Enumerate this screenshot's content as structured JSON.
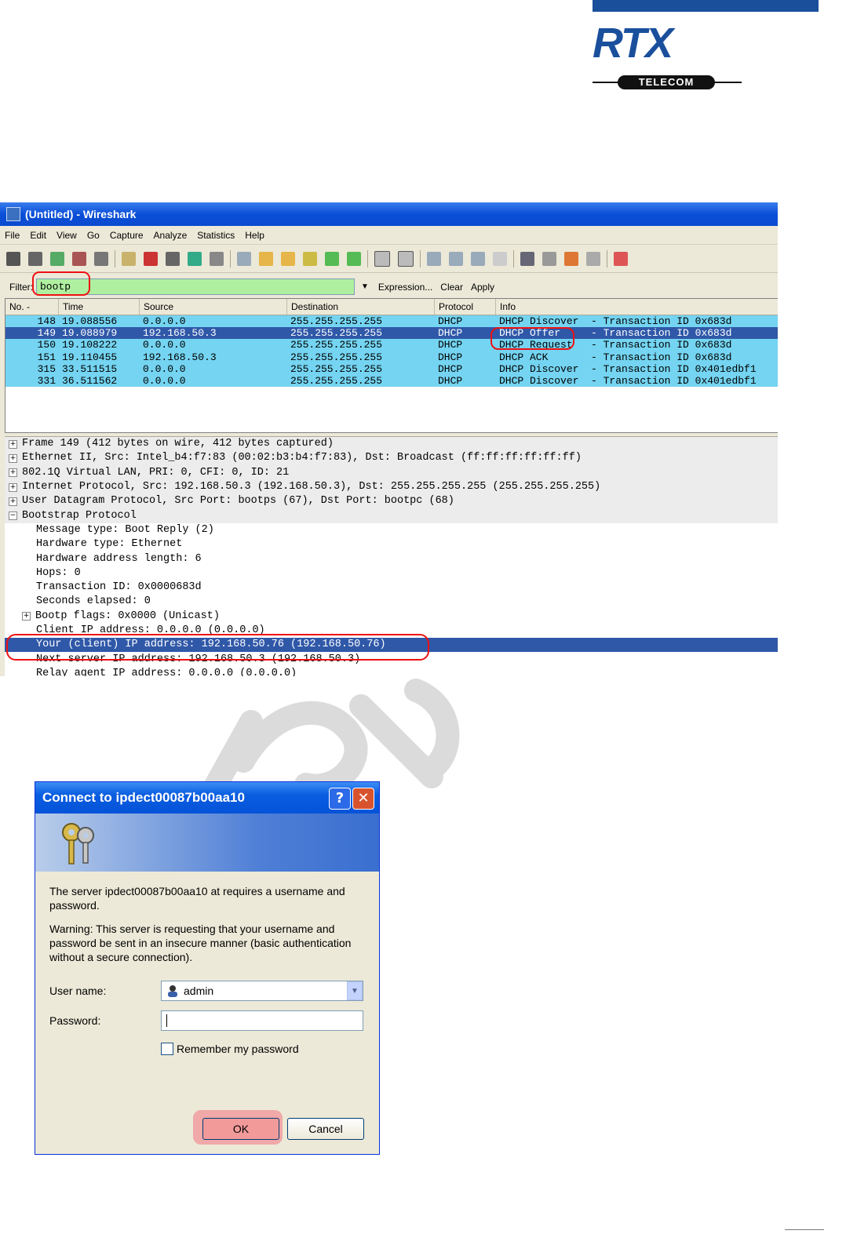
{
  "logo": {
    "name": "RTX",
    "sub": "TELECOM"
  },
  "wireshark": {
    "title": "(Untitled) - Wireshark",
    "menu": [
      "File",
      "Edit",
      "View",
      "Go",
      "Capture",
      "Analyze",
      "Statistics",
      "Help"
    ],
    "filter": {
      "label": "Filter:",
      "value": "bootp",
      "expression": "Expression...",
      "clear": "Clear",
      "apply": "Apply"
    },
    "columns": [
      "No. -",
      "Time",
      "Source",
      "Destination",
      "Protocol",
      "Info"
    ],
    "packets": [
      {
        "no": "148",
        "time": "19.088556",
        "src": "0.0.0.0",
        "dst": "255.255.255.255",
        "proto": "DHCP",
        "info": "DHCP Discover  - Transaction ID 0x683d"
      },
      {
        "no": "149",
        "time": "19.088979",
        "src": "192.168.50.3",
        "dst": "255.255.255.255",
        "proto": "DHCP",
        "info": "DHCP Offer     - Transaction ID 0x683d"
      },
      {
        "no": "150",
        "time": "19.108222",
        "src": "0.0.0.0",
        "dst": "255.255.255.255",
        "proto": "DHCP",
        "info": "DHCP Request   - Transaction ID 0x683d"
      },
      {
        "no": "151",
        "time": "19.110455",
        "src": "192.168.50.3",
        "dst": "255.255.255.255",
        "proto": "DHCP",
        "info": "DHCP ACK       - Transaction ID 0x683d"
      },
      {
        "no": "315",
        "time": "33.511515",
        "src": "0.0.0.0",
        "dst": "255.255.255.255",
        "proto": "DHCP",
        "info": "DHCP Discover  - Transaction ID 0x401edbf1"
      },
      {
        "no": "331",
        "time": "36.511562",
        "src": "0.0.0.0",
        "dst": "255.255.255.255",
        "proto": "DHCP",
        "info": "DHCP Discover  - Transaction ID 0x401edbf1"
      }
    ],
    "details": {
      "frame": "Frame 149 (412 bytes on wire, 412 bytes captured)",
      "ethernet": "Ethernet II, Src: Intel_b4:f7:83 (00:02:b3:b4:f7:83), Dst: Broadcast (ff:ff:ff:ff:ff:ff)",
      "vlan": "802.1Q Virtual LAN, PRI: 0, CFI: 0, ID: 21",
      "ip": "Internet Protocol, Src: 192.168.50.3 (192.168.50.3), Dst: 255.255.255.255 (255.255.255.255)",
      "udp": "User Datagram Protocol, Src Port: bootps (67), Dst Port: bootpc (68)",
      "bootstrap": "Bootstrap Protocol",
      "msg_type": "Message type: Boot Reply (2)",
      "hw_type": "Hardware type: Ethernet",
      "hw_len": "Hardware address length: 6",
      "hops": "Hops: 0",
      "xid": "Transaction ID: 0x0000683d",
      "secs": "Seconds elapsed: 0",
      "flags": "Bootp flags: 0x0000 (Unicast)",
      "ciaddr": "Client IP address: 0.0.0.0 (0.0.0.0)",
      "yiaddr": "Your (client) IP address: 192.168.50.76 (192.168.50.76)",
      "siaddr": "Next server IP address: 192.168.50.3 (192.168.50.3)",
      "giaddr": "Relay agent IP address: 0.0.0.0 (0.0.0.0)"
    }
  },
  "dialog": {
    "title": "Connect to ipdect00087b00aa10",
    "message": "The server ipdect00087b00aa10 at  requires a username and password.",
    "warning": "Warning: This server is requesting that your username and password be sent in an insecure manner (basic authentication without a secure connection).",
    "user_label": "User name:",
    "user_value": "admin",
    "password_label": "Password:",
    "password_value": "",
    "remember_label": "Remember my password",
    "ok": "OK",
    "cancel": "Cancel"
  },
  "colors": {
    "packet_row": "#74d4f1",
    "selected": "#3058a8",
    "filter_bg": "#aff0a0",
    "highlight": "#e11111"
  }
}
